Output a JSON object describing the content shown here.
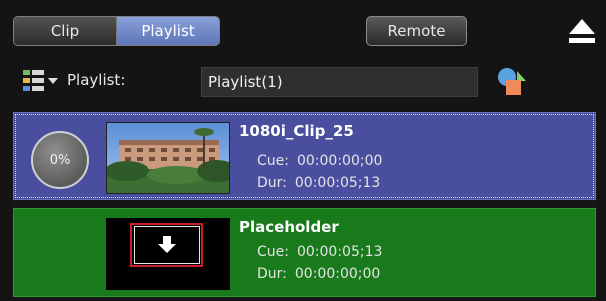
{
  "toolbar": {
    "tabs": [
      {
        "label": "Clip",
        "active": false
      },
      {
        "label": "Playlist",
        "active": true
      }
    ],
    "remote_label": "Remote",
    "eject_icon": "eject-icon"
  },
  "playlist": {
    "label": "Playlist:",
    "value": "Playlist(1)",
    "menu_icon": "playlist-menu-icon",
    "action_icon": "shapes-icon"
  },
  "items": [
    {
      "progress": "0%",
      "title": "1080i_Clip_25",
      "cue_label": "Cue:",
      "cue": "00:00:00;00",
      "dur_label": "Dur:",
      "dur": "00:00:05;13",
      "color": "#4a4e9f"
    },
    {
      "title": "Placeholder",
      "cue_label": "Cue:",
      "cue": "00:00:05;13",
      "dur_label": "Dur:",
      "dur": "00:00:00;00",
      "color": "#197a1c"
    }
  ],
  "colors": {
    "background": "#141414",
    "accent": "#6f86c8",
    "highlight": "#c81e28"
  }
}
